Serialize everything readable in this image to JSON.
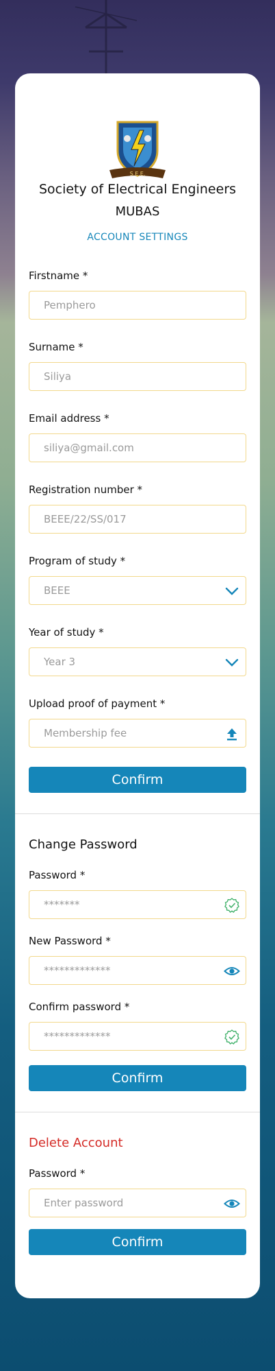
{
  "colors": {
    "accent": "#1586b9",
    "danger": "#d42a25",
    "field_border": "#f2d88b",
    "success": "#43b26c"
  },
  "header": {
    "org_name": "Society of Electrical Engineers",
    "org_short": "MUBAS",
    "section": "ACCOUNT SETTINGS",
    "logo_text": "S.E.E."
  },
  "profile": {
    "firstname": {
      "label": "Firstname *",
      "value": "Pemphero"
    },
    "surname": {
      "label": "Surname *",
      "value": "Siliya"
    },
    "email": {
      "label": "Email address *",
      "value": "siliya@gmail.com"
    },
    "regno": {
      "label": "Registration number *",
      "value": "BEEE/22/SS/017"
    },
    "program": {
      "label": "Program of study *",
      "value": "BEEE",
      "icon": "chevron-down-icon"
    },
    "year": {
      "label": "Year of study *",
      "value": "Year 3",
      "icon": "chevron-down-icon"
    },
    "payment": {
      "label": "Upload proof of payment *",
      "placeholder": "Membership fee",
      "icon": "upload-icon"
    },
    "confirm_label": "Confirm"
  },
  "change_password": {
    "title": "Change Password",
    "current": {
      "label": "Password *",
      "value": "*******",
      "icon": "check-badge-icon"
    },
    "new": {
      "label": "New Password *",
      "value": "*************",
      "icon": "eye-icon"
    },
    "confirm": {
      "label": "Confirm password *",
      "value": "*************",
      "icon": "check-badge-icon"
    },
    "confirm_label": "Confirm"
  },
  "delete_account": {
    "title": "Delete Account",
    "password": {
      "label": "Password *",
      "placeholder": "Enter password",
      "icon": "eye-icon"
    },
    "confirm_label": "Confirm"
  }
}
